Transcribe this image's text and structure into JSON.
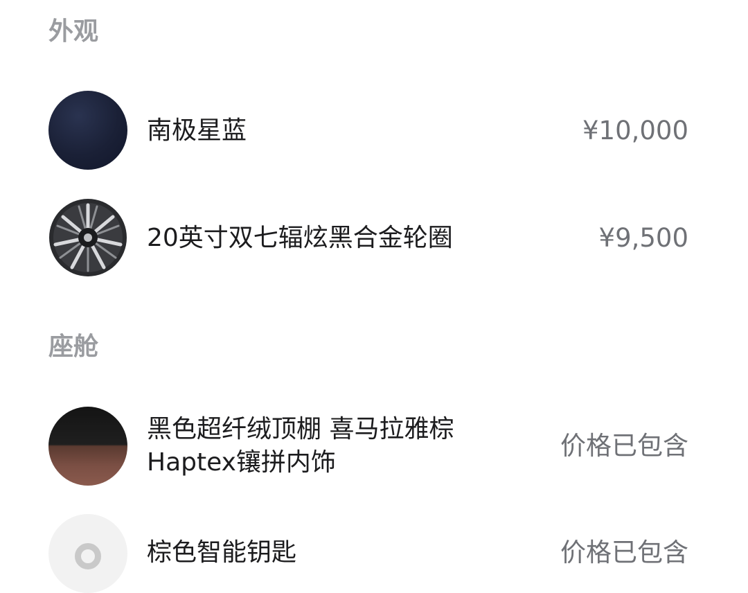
{
  "sections": [
    {
      "title": "外观",
      "items": [
        {
          "name": "南极星蓝",
          "price": "¥10,000",
          "thumbnail": "color-swatch-navy"
        },
        {
          "name": "20英寸双七辐炫黑合金轮圈",
          "price": "¥9,500",
          "thumbnail": "wheel-rim"
        }
      ]
    },
    {
      "title": "座舱",
      "items": [
        {
          "name_line1": "黑色超纤绒顶棚 喜马拉雅棕",
          "name_line2": "Haptex镶拼内饰",
          "price": "价格已包含",
          "thumbnail": "interior-swatch"
        },
        {
          "name": "棕色智能钥匙",
          "price": "价格已包含",
          "thumbnail": "smart-key"
        }
      ]
    }
  ],
  "colors": {
    "section_title": "#9a9ca0",
    "item_text": "#1c1c1e",
    "price_text": "#6f7176",
    "swatch_navy": "#1a2036",
    "interior_top": "#141414",
    "interior_bottom": "#7b4f44"
  }
}
